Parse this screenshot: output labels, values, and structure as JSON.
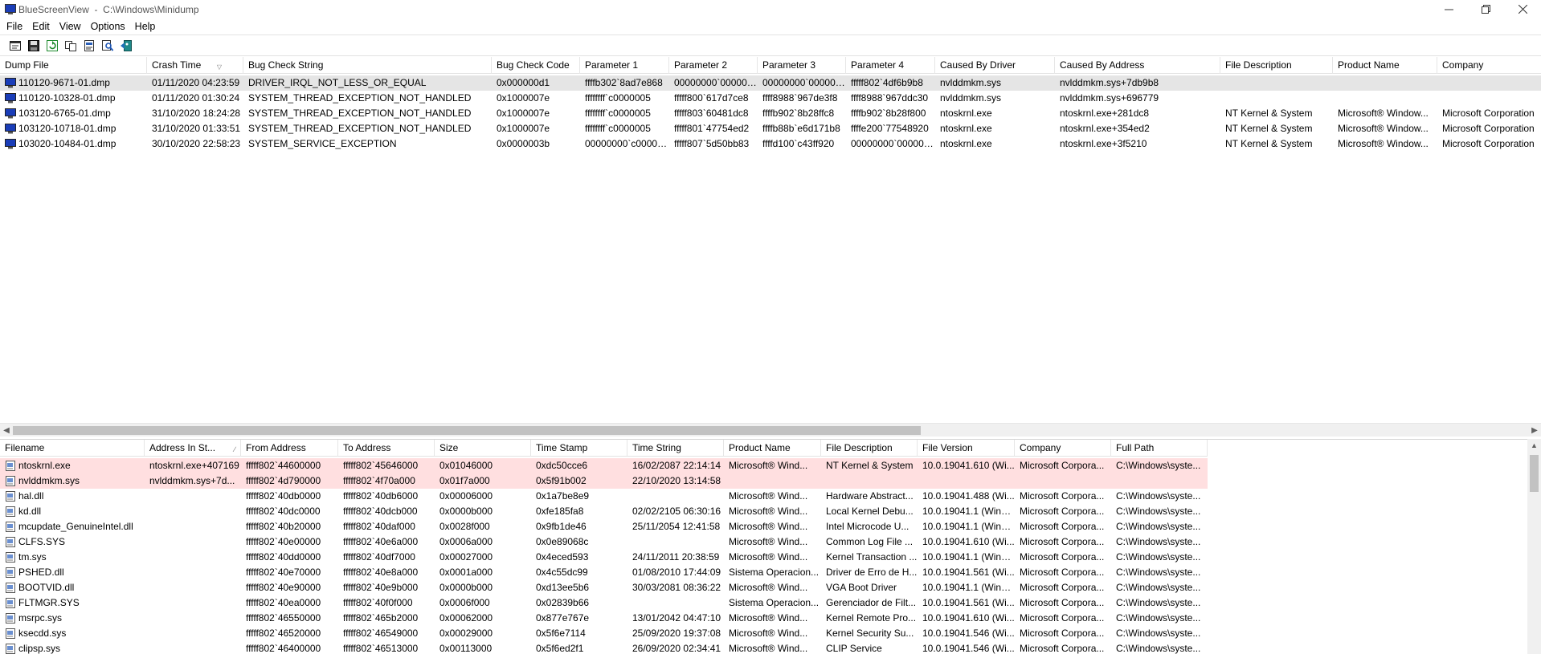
{
  "window": {
    "title": "BlueScreenView  -  C:\\Windows\\Minidump"
  },
  "menu": [
    "File",
    "Edit",
    "View",
    "Options",
    "Help"
  ],
  "toolbar": [
    "properties-icon",
    "save-icon",
    "refresh-icon",
    "copy-icon",
    "html-report-icon",
    "find-icon",
    "exit-icon"
  ],
  "dumps": {
    "columns": [
      "Dump File",
      "Crash Time",
      "Bug Check String",
      "Bug Check Code",
      "Parameter 1",
      "Parameter 2",
      "Parameter 3",
      "Parameter 4",
      "Caused By Driver",
      "Caused By Address",
      "File Description",
      "Product Name",
      "Company"
    ],
    "sort_column": 1,
    "rows": [
      [
        "110120-9671-01.dmp",
        "01/11/2020 04:23:59",
        "DRIVER_IRQL_NOT_LESS_OR_EQUAL",
        "0x000000d1",
        "ffffb302`8ad7e868",
        "00000000`000000...",
        "00000000`000000...",
        "fffff802`4df6b9b8",
        "nvlddmkm.sys",
        "nvlddmkm.sys+7db9b8",
        "",
        "",
        ""
      ],
      [
        "110120-10328-01.dmp",
        "01/11/2020 01:30:24",
        "SYSTEM_THREAD_EXCEPTION_NOT_HANDLED",
        "0x1000007e",
        "ffffffff`c0000005",
        "fffff800`617d7ce8",
        "ffff8988`967de3f8",
        "ffff8988`967ddc30",
        "nvlddmkm.sys",
        "nvlddmkm.sys+696779",
        "",
        "",
        ""
      ],
      [
        "103120-6765-01.dmp",
        "31/10/2020 18:24:28",
        "SYSTEM_THREAD_EXCEPTION_NOT_HANDLED",
        "0x1000007e",
        "ffffffff`c0000005",
        "fffff803`60481dc8",
        "ffffb902`8b28ffc8",
        "ffffb902`8b28f800",
        "ntoskrnl.exe",
        "ntoskrnl.exe+281dc8",
        "NT Kernel & System",
        "Microsoft® Window...",
        "Microsoft Corporation"
      ],
      [
        "103120-10718-01.dmp",
        "31/10/2020 01:33:51",
        "SYSTEM_THREAD_EXCEPTION_NOT_HANDLED",
        "0x1000007e",
        "ffffffff`c0000005",
        "fffff801`47754ed2",
        "ffffb88b`e6d171b8",
        "ffffe200`77548920",
        "ntoskrnl.exe",
        "ntoskrnl.exe+354ed2",
        "NT Kernel & System",
        "Microsoft® Window...",
        "Microsoft Corporation"
      ],
      [
        "103020-10484-01.dmp",
        "30/10/2020 22:58:23",
        "SYSTEM_SERVICE_EXCEPTION",
        "0x0000003b",
        "00000000`c00000...",
        "fffff807`5d50bb83",
        "ffffd100`c43ff920",
        "00000000`000000...",
        "ntoskrnl.exe",
        "ntoskrnl.exe+3f5210",
        "NT Kernel & System",
        "Microsoft® Window...",
        "Microsoft Corporation"
      ]
    ]
  },
  "modules": {
    "columns": [
      "Filename",
      "Address In St...",
      "From Address",
      "To Address",
      "Size",
      "Time Stamp",
      "Time String",
      "Product Name",
      "File Description",
      "File Version",
      "Company",
      "Full Path"
    ],
    "sort_column": 1,
    "rows": [
      [
        "ntoskrnl.exe",
        "ntoskrnl.exe+407169",
        "fffff802`44600000",
        "fffff802`45646000",
        "0x01046000",
        "0xdc50cce6",
        "16/02/2087 22:14:14",
        "Microsoft® Wind...",
        "NT Kernel & System",
        "10.0.19041.610 (Wi...",
        "Microsoft Corpora...",
        "C:\\Windows\\syste..."
      ],
      [
        "nvlddmkm.sys",
        "nvlddmkm.sys+7d...",
        "fffff802`4d790000",
        "fffff802`4f70a000",
        "0x01f7a000",
        "0x5f91b002",
        "22/10/2020 13:14:58",
        "",
        "",
        "",
        "",
        ""
      ],
      [
        "hal.dll",
        "",
        "fffff802`40db0000",
        "fffff802`40db6000",
        "0x00006000",
        "0x1a7be8e9",
        "",
        "Microsoft® Wind...",
        "Hardware Abstract...",
        "10.0.19041.488 (Wi...",
        "Microsoft Corpora...",
        "C:\\Windows\\syste..."
      ],
      [
        "kd.dll",
        "",
        "fffff802`40dc0000",
        "fffff802`40dcb000",
        "0x0000b000",
        "0xfe185fa8",
        "02/02/2105 06:30:16",
        "Microsoft® Wind...",
        "Local Kernel Debu...",
        "10.0.19041.1 (WinB...",
        "Microsoft Corpora...",
        "C:\\Windows\\syste..."
      ],
      [
        "mcupdate_GenuineIntel.dll",
        "",
        "fffff802`40b20000",
        "fffff802`40daf000",
        "0x0028f000",
        "0x9fb1de46",
        "25/11/2054 12:41:58",
        "Microsoft® Wind...",
        "Intel Microcode U...",
        "10.0.19041.1 (WinB...",
        "Microsoft Corpora...",
        "C:\\Windows\\syste..."
      ],
      [
        "CLFS.SYS",
        "",
        "fffff802`40e00000",
        "fffff802`40e6a000",
        "0x0006a000",
        "0x0e89068c",
        "",
        "Microsoft® Wind...",
        "Common Log File ...",
        "10.0.19041.610 (Wi...",
        "Microsoft Corpora...",
        "C:\\Windows\\syste..."
      ],
      [
        "tm.sys",
        "",
        "fffff802`40dd0000",
        "fffff802`40df7000",
        "0x00027000",
        "0x4eced593",
        "24/11/2011 20:38:59",
        "Microsoft® Wind...",
        "Kernel Transaction ...",
        "10.0.19041.1 (WinB...",
        "Microsoft Corpora...",
        "C:\\Windows\\syste..."
      ],
      [
        "PSHED.dll",
        "",
        "fffff802`40e70000",
        "fffff802`40e8a000",
        "0x0001a000",
        "0x4c55dc99",
        "01/08/2010 17:44:09",
        "Sistema Operacion...",
        "Driver de Erro de H...",
        "10.0.19041.561 (Wi...",
        "Microsoft Corpora...",
        "C:\\Windows\\syste..."
      ],
      [
        "BOOTVID.dll",
        "",
        "fffff802`40e90000",
        "fffff802`40e9b000",
        "0x0000b000",
        "0xd13ee5b6",
        "30/03/2081 08:36:22",
        "Microsoft® Wind...",
        "VGA Boot Driver",
        "10.0.19041.1 (WinB...",
        "Microsoft Corpora...",
        "C:\\Windows\\syste..."
      ],
      [
        "FLTMGR.SYS",
        "",
        "fffff802`40ea0000",
        "fffff802`40f0f000",
        "0x0006f000",
        "0x02839b66",
        "",
        "Sistema Operacion...",
        "Gerenciador de Filt...",
        "10.0.19041.561 (Wi...",
        "Microsoft Corpora...",
        "C:\\Windows\\syste..."
      ],
      [
        "msrpc.sys",
        "",
        "fffff802`46550000",
        "fffff802`465b2000",
        "0x00062000",
        "0x877e767e",
        "13/01/2042 04:47:10",
        "Microsoft® Wind...",
        "Kernel Remote Pro...",
        "10.0.19041.610 (Wi...",
        "Microsoft Corpora...",
        "C:\\Windows\\syste..."
      ],
      [
        "ksecdd.sys",
        "",
        "fffff802`46520000",
        "fffff802`46549000",
        "0x00029000",
        "0x5f6e7114",
        "25/09/2020 19:37:08",
        "Microsoft® Wind...",
        "Kernel Security Su...",
        "10.0.19041.546 (Wi...",
        "Microsoft Corpora...",
        "C:\\Windows\\syste..."
      ],
      [
        "clipsp.sys",
        "",
        "fffff802`46400000",
        "fffff802`46513000",
        "0x00113000",
        "0x5f6ed2f1",
        "26/09/2020 02:34:41",
        "Microsoft® Wind...",
        "CLIP Service",
        "10.0.19041.546 (Wi...",
        "Microsoft Corpora...",
        "C:\\Windows\\syste..."
      ]
    ]
  },
  "colors": {
    "highlight_row": "#ffdfe0",
    "selected_row": "#e5e5e5"
  }
}
